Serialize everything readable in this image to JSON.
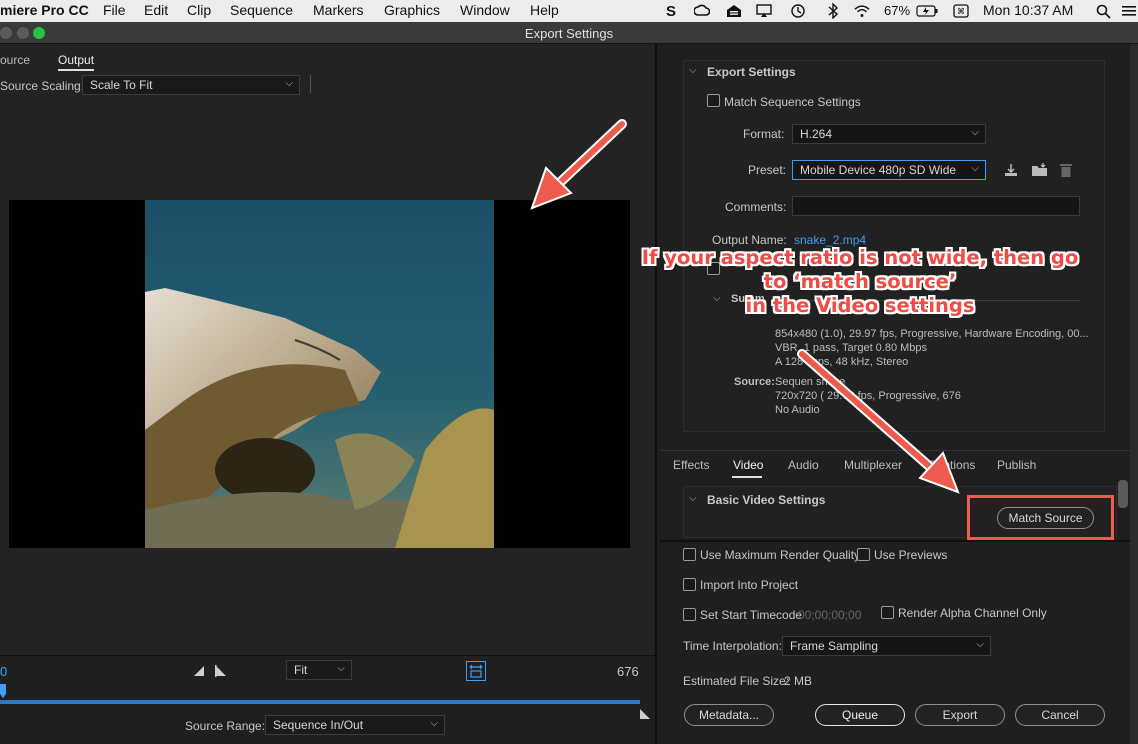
{
  "menubar": {
    "app_name": "miere Pro CC",
    "items": [
      "File",
      "Edit",
      "Clip",
      "Sequence",
      "Markers",
      "Graphics",
      "Window",
      "Help"
    ],
    "battery": "67%",
    "clock": "Mon 10:37 AM",
    "status_icons": [
      "skype-icon",
      "creative-cloud-icon",
      "dropbox-icon",
      "airplay-icon",
      "time-machine-icon",
      "bluetooth-icon",
      "wifi-icon",
      "battery-icon",
      "input-source-icon",
      "search-icon"
    ]
  },
  "window": {
    "title": "Export Settings"
  },
  "left": {
    "tabs": [
      "ource",
      "Output"
    ],
    "active_tab": "Output",
    "source_scaling_label": "Source Scaling:",
    "source_scaling_value": "Scale To Fit",
    "timecode_start": "0",
    "timecode_end": "676",
    "zoom_value": "Fit",
    "source_range_label": "Source Range:",
    "source_range_value": "Sequence In/Out"
  },
  "export_settings": {
    "header": "Export Settings",
    "match_sequence_label": "Match Sequence Settings",
    "format_label": "Format:",
    "format_value": "H.264",
    "preset_label": "Preset:",
    "preset_value": "Mobile Device 480p SD Wide",
    "comments_label": "Comments:",
    "comments_value": "",
    "output_name_label": "Output Name:",
    "output_name_value": "snake_2.mp4",
    "summary_header": "Summ",
    "output_summary_lines": [
      "854x480 (1.0), 29.97 fps, Progressive, Hardware Encoding, 00...",
      "VBR, 1 pass, Target 0.80 Mbps",
      "A   128 kbps, 48 kHz, Stereo"
    ],
    "source_label": "Source:",
    "source_lines": [
      "Sequen      snake",
      "720x720 (     29.78 fps, Progressive, 676",
      "No Audio"
    ]
  },
  "tabs_right": {
    "items": [
      "Effects",
      "Video",
      "Audio",
      "Multiplexer",
      "Captions",
      "Publish"
    ],
    "active": "Video"
  },
  "video_settings": {
    "header": "Basic Video Settings",
    "match_source_label": "Match Source"
  },
  "options": {
    "max_render_quality": "Use Maximum Render Quality",
    "use_previews": "Use Previews",
    "import_into_project": "Import Into Project",
    "set_start_timecode": "Set Start Timecode",
    "start_timecode_value": "00;00;00;00",
    "render_alpha": "Render Alpha Channel Only",
    "time_interpolation_label": "Time Interpolation:",
    "time_interpolation_value": "Frame Sampling",
    "estimated_size_label": "Estimated File Size:",
    "estimated_size_value": "2 MB"
  },
  "buttons": {
    "metadata": "Metadata...",
    "queue": "Queue",
    "export": "Export",
    "cancel": "Cancel"
  },
  "annotation": {
    "lines": [
      "If your aspect ratio is not wide, then go",
      "to ‘match source’",
      "in the Video settings"
    ],
    "color": "#f24b45"
  }
}
